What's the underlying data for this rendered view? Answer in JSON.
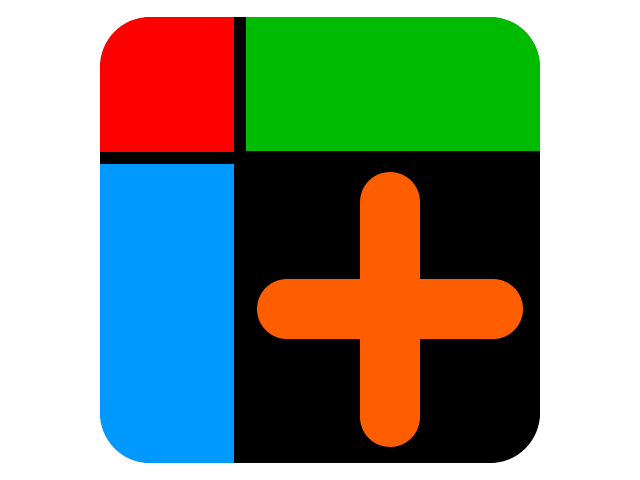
{
  "icon": {
    "name": "plus-app-icon",
    "colors": {
      "red": "#ff0000",
      "green": "#00bb00",
      "blue": "#0099ff",
      "black": "#000000",
      "plus": "#ff5e00",
      "background": "#ffffff"
    }
  }
}
